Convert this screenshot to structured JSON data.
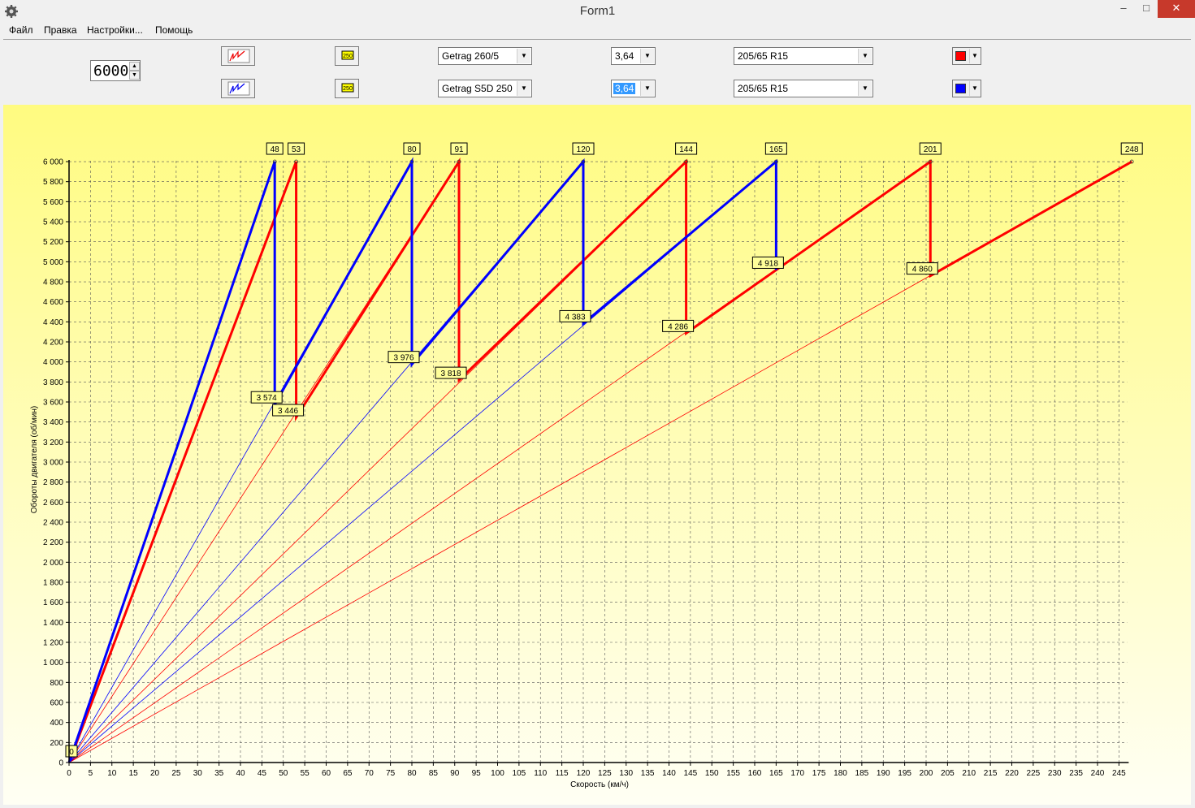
{
  "window": {
    "title": "Form1",
    "minimize": "–",
    "maximize": "□",
    "close": "✕",
    "icon": "gear-icon"
  },
  "menu": [
    {
      "label": "Файл"
    },
    {
      "label": "Правка"
    },
    {
      "label": "Настройки..."
    },
    {
      "label": "Помощь"
    }
  ],
  "toolbar": {
    "rpm_value": "6000",
    "rows": [
      {
        "gearbox": "Getrag 260/5",
        "ratio": "3,64",
        "ratio_selected": false,
        "tire": "205/65 R15",
        "color": "#ff0000",
        "chart_icon": "chart-icon-red",
        "speed_icon": "speed-limit-icon",
        "speed_icon_text": "250"
      },
      {
        "gearbox": "Getrag S5D 250",
        "ratio": "3,64",
        "ratio_selected": true,
        "tire": "205/65 R15",
        "color": "#0000ff",
        "chart_icon": "chart-icon-blue",
        "speed_icon": "speed-limit-icon",
        "speed_icon_text": "250"
      }
    ]
  },
  "chart_data": {
    "type": "line",
    "xlabel": "Скорость (км/ч)",
    "ylabel": "Обороты двигателя (об/мин)",
    "xlim": [
      0,
      250
    ],
    "ylim": [
      0,
      6000
    ],
    "x_ticks": [
      0,
      5,
      10,
      15,
      20,
      25,
      30,
      35,
      40,
      45,
      50,
      55,
      60,
      65,
      70,
      75,
      80,
      85,
      90,
      95,
      100,
      105,
      110,
      115,
      120,
      125,
      130,
      135,
      140,
      145,
      150,
      155,
      160,
      165,
      170,
      175,
      180,
      185,
      190,
      195,
      200,
      205,
      210,
      215,
      220,
      225,
      230,
      235,
      240,
      245
    ],
    "y_ticks": [
      0,
      200,
      400,
      600,
      800,
      1000,
      1200,
      1400,
      1600,
      1800,
      2000,
      2200,
      2400,
      2600,
      2800,
      3000,
      3200,
      3400,
      3600,
      3800,
      4000,
      4200,
      4400,
      4600,
      4800,
      5000,
      5200,
      5400,
      5600,
      5800,
      6000
    ],
    "y_tick_labels": [
      "0",
      "200",
      "400",
      "600",
      "800",
      "1 000",
      "1 200",
      "1 400",
      "1 600",
      "1 800",
      "2 000",
      "2 200",
      "2 400",
      "2 600",
      "2 800",
      "3 000",
      "3 200",
      "3 400",
      "3 600",
      "3 800",
      "4 000",
      "4 200",
      "4 400",
      "4 600",
      "4 800",
      "5 000",
      "5 200",
      "5 400",
      "5 600",
      "5 800",
      "6 000"
    ],
    "grid": true,
    "max_rpm": 6000,
    "series": [
      {
        "color": "#ff0000",
        "shift_speeds": [
          53,
          91,
          144,
          201,
          248
        ],
        "shift_rpms": [
          3446,
          3818,
          4286,
          4860
        ]
      },
      {
        "color": "#0000ff",
        "shift_speeds": [
          48,
          80,
          120,
          165
        ],
        "shift_rpms": [
          3574,
          3976,
          4383,
          4918
        ]
      }
    ],
    "top_labels": [
      "48",
      "53",
      "80",
      "91",
      "120",
      "144",
      "165",
      "201",
      "248"
    ],
    "drop_labels": [
      "3 574",
      "3 446",
      "3 976",
      "3 818",
      "4 383",
      "4 286",
      "4 918",
      "4 860"
    ],
    "origin_label": "0"
  }
}
